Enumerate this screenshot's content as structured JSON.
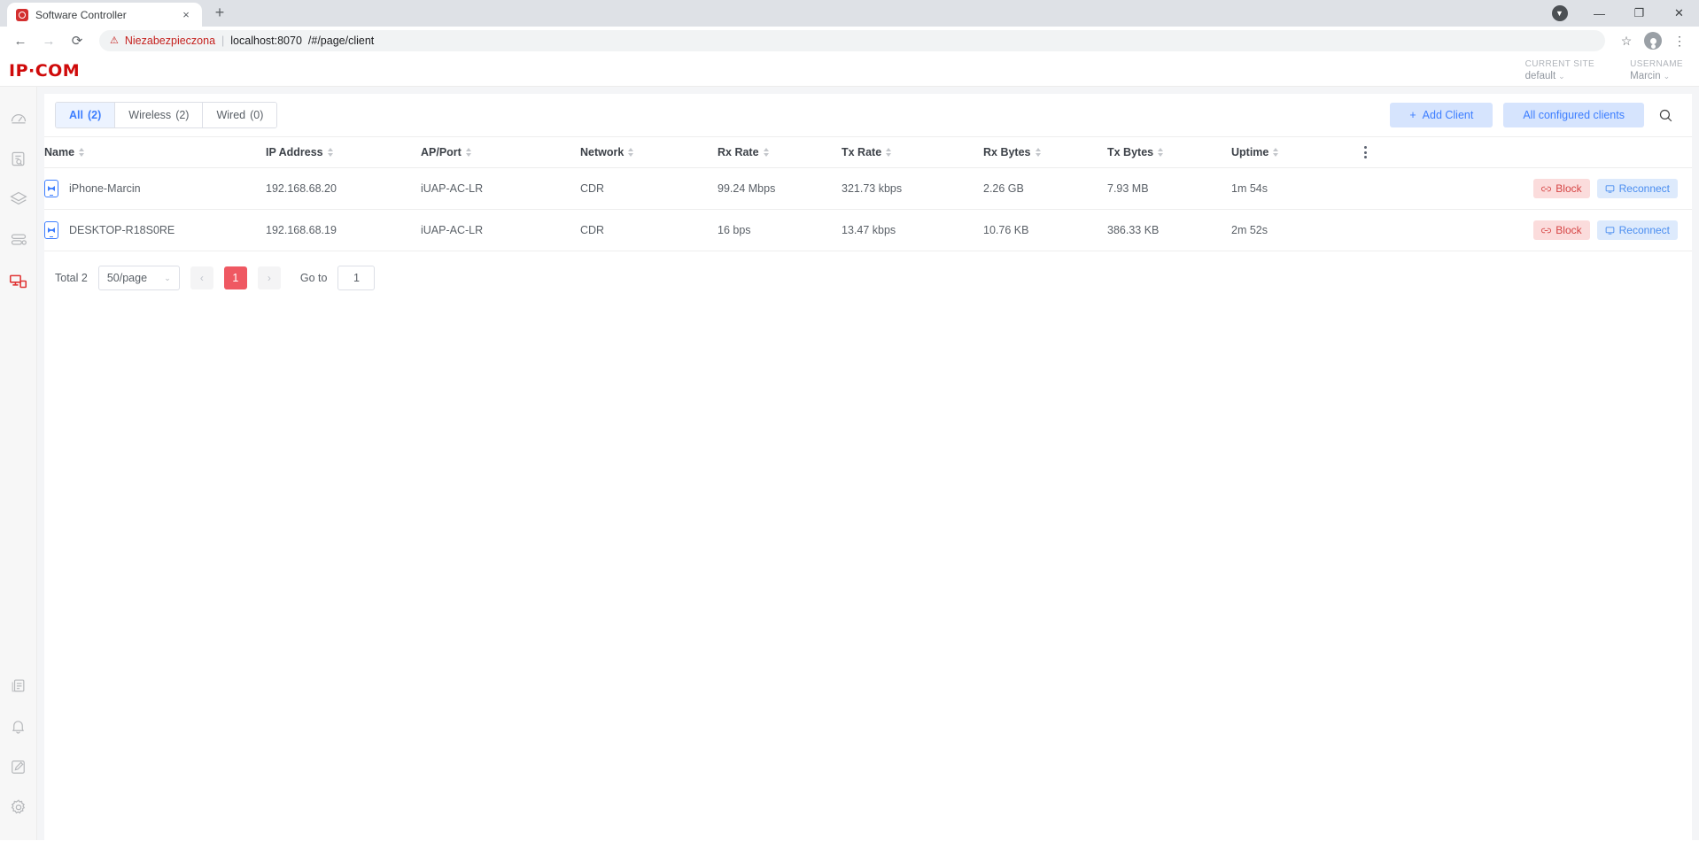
{
  "browser": {
    "tab_title": "Software Controller",
    "tab_close": "×",
    "new_tab": "+",
    "back": "←",
    "forward": "→",
    "reload": "⟳",
    "security_warning": "Niezabezpieczona",
    "url_host": "localhost:8070",
    "url_path": "/#/page/client",
    "bookmark": "☆",
    "menu": "⋮",
    "minimize": "—",
    "maximize": "❐",
    "close": "✕",
    "update_badge": "▼"
  },
  "header": {
    "logo": "IP·COM",
    "current_site_label": "CURRENT SITE",
    "current_site_value": "default",
    "username_label": "USERNAME",
    "username_value": "Marcin",
    "caret": "⌄"
  },
  "sidebar": {
    "items": [
      {
        "name": "dashboard-icon",
        "active": false
      },
      {
        "name": "insight-icon",
        "active": false
      },
      {
        "name": "layers-icon",
        "active": false
      },
      {
        "name": "devices-icon",
        "active": false
      },
      {
        "name": "clients-icon",
        "active": true
      }
    ],
    "bottom_items": [
      {
        "name": "logs-icon",
        "active": false
      },
      {
        "name": "alerts-icon",
        "active": false
      },
      {
        "name": "edit-icon",
        "active": false
      },
      {
        "name": "settings-icon",
        "active": false
      }
    ]
  },
  "toolbar": {
    "tabs": [
      {
        "label": "All",
        "count": "(2)",
        "active": true
      },
      {
        "label": "Wireless",
        "count": "(2)",
        "active": false
      },
      {
        "label": "Wired",
        "count": "(0)",
        "active": false
      }
    ],
    "add_client_label": "Add Client",
    "add_client_icon": "+",
    "all_configured_label": "All configured clients",
    "search_icon": "search-icon"
  },
  "table": {
    "columns": [
      "Name",
      "IP Address",
      "AP/Port",
      "Network",
      "Rx Rate",
      "Tx Rate",
      "Rx Bytes",
      "Tx Bytes",
      "Uptime"
    ],
    "rows": [
      {
        "name": "iPhone-Marcin",
        "ip": "192.168.68.20",
        "ap_port": "iUAP-AC-LR",
        "network": "CDR",
        "rx_rate": "99.24 Mbps",
        "tx_rate": "321.73 kbps",
        "rx_bytes": "2.26 GB",
        "tx_bytes": "7.93 MB",
        "uptime": "1m 54s"
      },
      {
        "name": "DESKTOP-R18S0RE",
        "ip": "192.168.68.19",
        "ap_port": "iUAP-AC-LR",
        "network": "CDR",
        "rx_rate": "16 bps",
        "tx_rate": "13.47 kbps",
        "rx_bytes": "10.76 KB",
        "tx_bytes": "386.33 KB",
        "uptime": "2m 52s"
      }
    ],
    "block_label": "Block",
    "reconnect_label": "Reconnect"
  },
  "pagination": {
    "total": "Total 2",
    "page_size": "50/page",
    "prev": "‹",
    "next": "›",
    "current_page": "1",
    "goto_label": "Go to",
    "goto_value": "1"
  },
  "colors": {
    "brand_red": "#cf0a0a",
    "accent_blue": "#3d7eff",
    "active_page_red": "#ef5862",
    "block_red": "#d64545"
  }
}
